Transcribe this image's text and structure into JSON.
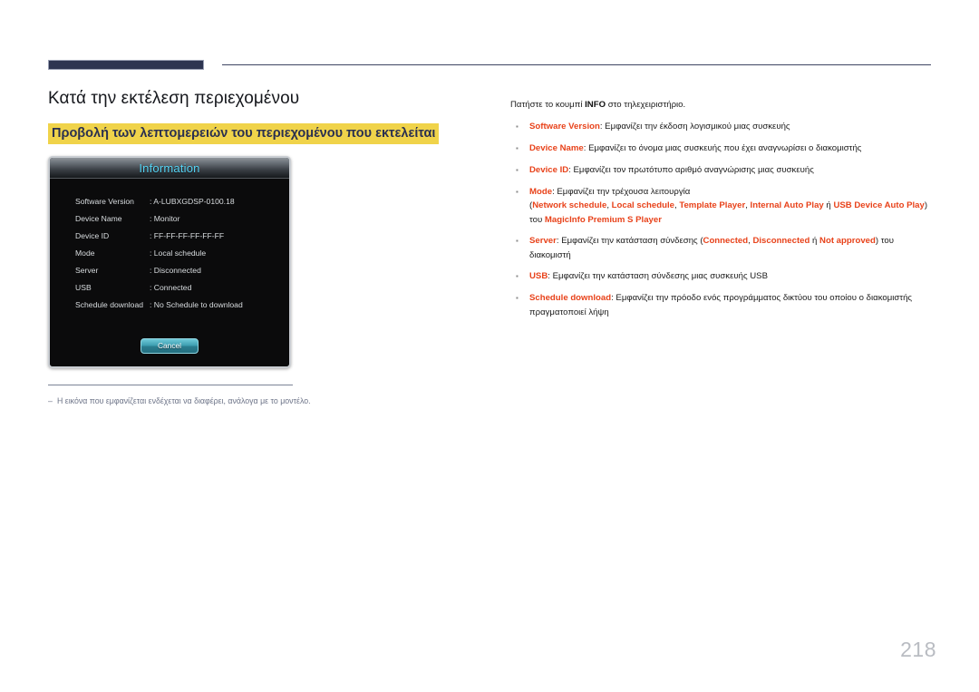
{
  "page": {
    "number": "218",
    "title": "Κατά την εκτέλεση περιεχομένου",
    "subheading": "Προβολή των λεπτομερειών του περιεχομένου που εκτελείται",
    "accent_highlight": "#f0d34a",
    "accent_term": "#e8421a",
    "rule_navy": "#2e3551"
  },
  "dialog": {
    "title": "Information",
    "title_color": "#55d4f5",
    "rows": [
      {
        "label": "Software Version",
        "value": ": A-LUBXGDSP-0100.18"
      },
      {
        "label": "Device Name",
        "value": ": Monitor"
      },
      {
        "label": "Device ID",
        "value": ": FF-FF-FF-FF-FF-FF"
      },
      {
        "label": "Mode",
        "value": ": Local schedule"
      },
      {
        "label": "Server",
        "value": ": Disconnected"
      },
      {
        "label": "USB",
        "value": ": Connected"
      },
      {
        "label": "Schedule download",
        "value": ": No Schedule to download"
      }
    ],
    "cancel_label": "Cancel"
  },
  "note": {
    "rule": true,
    "dash": "‒",
    "text": "Η εικόνα που εμφανίζεται ενδέχεται να διαφέρει, ανάλογα με το μοντέλο."
  },
  "right": {
    "intro_before": "Πατήστε το κουμπί ",
    "intro_bold": "INFO",
    "intro_after": " στο τηλεχειριστήριο.",
    "bullet_marker": "▪",
    "bullets": [
      {
        "parts": [
          {
            "t": "Software Version",
            "hl": true
          },
          {
            "t": ": Εμφανίζει την έκδοση λογισμικού μιας συσκευής",
            "hl": false
          }
        ]
      },
      {
        "parts": [
          {
            "t": "Device Name",
            "hl": true
          },
          {
            "t": ": Εμφανίζει το όνομα μιας συσκευής που έχει αναγνωρίσει ο διακομιστής",
            "hl": false
          }
        ]
      },
      {
        "parts": [
          {
            "t": "Device ID",
            "hl": true
          },
          {
            "t": ": Εμφανίζει τον πρωτότυπο αριθμό αναγνώρισης μιας συσκευής",
            "hl": false
          }
        ]
      },
      {
        "parts": [
          {
            "t": "Mode",
            "hl": true
          },
          {
            "t": ": Εμφανίζει την τρέχουσα λειτουργία",
            "hl": false
          },
          {
            "t": "\n",
            "hl": false
          },
          {
            "t": "(",
            "hl": false
          },
          {
            "t": "Network schedule",
            "hl": true
          },
          {
            "t": ", ",
            "hl": false
          },
          {
            "t": "Local schedule",
            "hl": true
          },
          {
            "t": ", ",
            "hl": false
          },
          {
            "t": "Template Player",
            "hl": true
          },
          {
            "t": ", ",
            "hl": false
          },
          {
            "t": "Internal Auto Play",
            "hl": true
          },
          {
            "t": " ή ",
            "hl": false
          },
          {
            "t": "USB Device Auto Play",
            "hl": true
          },
          {
            "t": ") του ",
            "hl": false
          },
          {
            "t": "MagicInfo Premium S Player",
            "hl": true
          }
        ]
      },
      {
        "parts": [
          {
            "t": "Server",
            "hl": true
          },
          {
            "t": ": Εμφανίζει την κατάσταση σύνδεσης (",
            "hl": false
          },
          {
            "t": "Connected",
            "hl": true
          },
          {
            "t": ", ",
            "hl": false
          },
          {
            "t": "Disconnected",
            "hl": true
          },
          {
            "t": " ή ",
            "hl": false
          },
          {
            "t": "Not approved",
            "hl": true
          },
          {
            "t": ") του διακομιστή",
            "hl": false
          }
        ]
      },
      {
        "parts": [
          {
            "t": "USB",
            "hl": true
          },
          {
            "t": ": Εμφανίζει την κατάσταση σύνδεσης μιας συσκευής USB",
            "hl": false
          }
        ]
      },
      {
        "parts": [
          {
            "t": "Schedule download",
            "hl": true
          },
          {
            "t": ": Εμφανίζει την πρόοδο ενός προγράμματος δικτύου του οποίου ο διακομιστής πραγματοποιεί λήψη",
            "hl": false
          }
        ]
      }
    ]
  }
}
